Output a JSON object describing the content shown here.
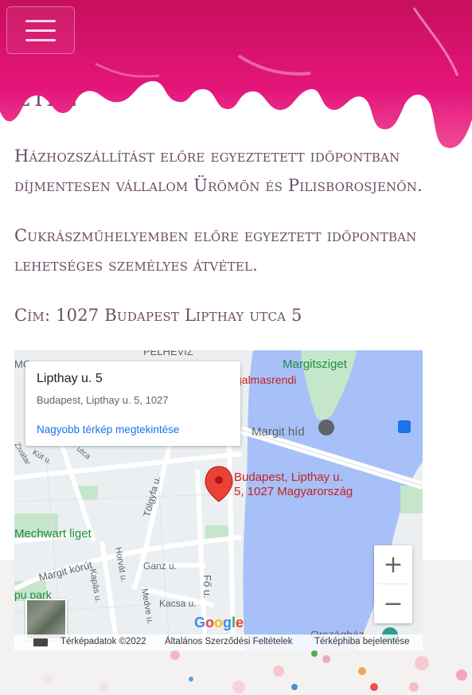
{
  "header": {
    "menu_icon": "hamburger-menu-icon",
    "partial_title": "VÉTEL",
    "drip_color": "#e4157a"
  },
  "content": {
    "paragraph1": "Házhozszállítást előre egyeztetett időpontban díjmentesen vállalom Ürömön és Pilisborosjenőn.",
    "paragraph2": "Cukrászműhelyemben előre egyeztett időpontban lehetséges személyes átvétel.",
    "address": "Cím: 1027 Budapest Lipthay utca 5"
  },
  "map": {
    "card_title": "Lipthay u. 5",
    "card_address": "Budapest, Lipthay u. 5, 1027",
    "card_link": "Nagyobb térkép megtekintése",
    "marker_label_line1": "Budapest, Lipthay u.",
    "marker_label_line2": "5, 1027 Magyarország",
    "zoom_in": "+",
    "zoom_out": "−",
    "google_logo": "Google",
    "labels": {
      "margitsziget": "Margitsziget",
      "margit_hid": "Margit híd",
      "mechwart": "Mechwart liget",
      "margit_korut": "Margit körút",
      "tolgyfa": "Tölgyfa u.",
      "ganz": "Ganz u.",
      "kacsa": "Kacsa u.",
      "fo_u": "Fő u.",
      "kapas": "Kapás u.",
      "medve": "Medve u.",
      "horvat": "Horvát u.",
      "galmasrendi": "galmasrendi",
      "orszaghaz": "Országház",
      "park": "pu park",
      "kut": "Kút u.",
      "zivatar": "Zivatar",
      "utca": "utca",
      "lepvesz": "PELHEVIZ",
      "mc": "MC"
    },
    "footer": {
      "keyboard_icon": "keyboard-icon",
      "data": "Térképadatok ©2022",
      "terms": "Általános Szerződési Feltételek",
      "report": "Térképhiba bejelentése"
    },
    "colors": {
      "water": "#a7c0f7",
      "land": "#eceff1",
      "park": "#c6e6cc",
      "road": "#ffffff",
      "marker": "#ea4335"
    }
  }
}
